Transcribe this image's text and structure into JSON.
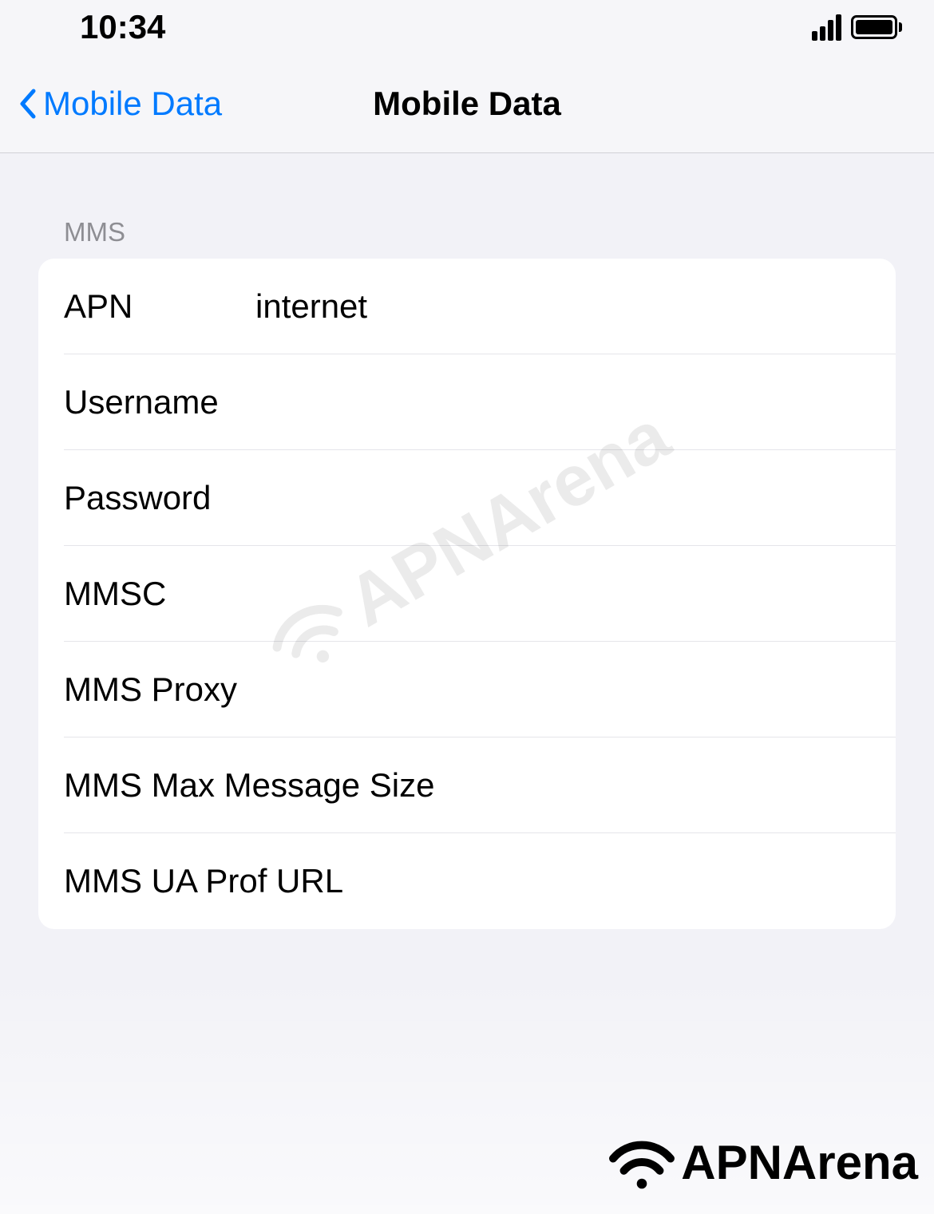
{
  "statusBar": {
    "time": "10:34"
  },
  "navBar": {
    "backLabel": "Mobile Data",
    "title": "Mobile Data"
  },
  "section": {
    "header": "MMS",
    "rows": [
      {
        "label": "APN",
        "value": "internet"
      },
      {
        "label": "Username",
        "value": ""
      },
      {
        "label": "Password",
        "value": ""
      },
      {
        "label": "MMSC",
        "value": ""
      },
      {
        "label": "MMS Proxy",
        "value": ""
      },
      {
        "label": "MMS Max Message Size",
        "value": ""
      },
      {
        "label": "MMS UA Prof URL",
        "value": ""
      }
    ]
  },
  "watermark": "APNArena",
  "footerLogo": "APNArena"
}
